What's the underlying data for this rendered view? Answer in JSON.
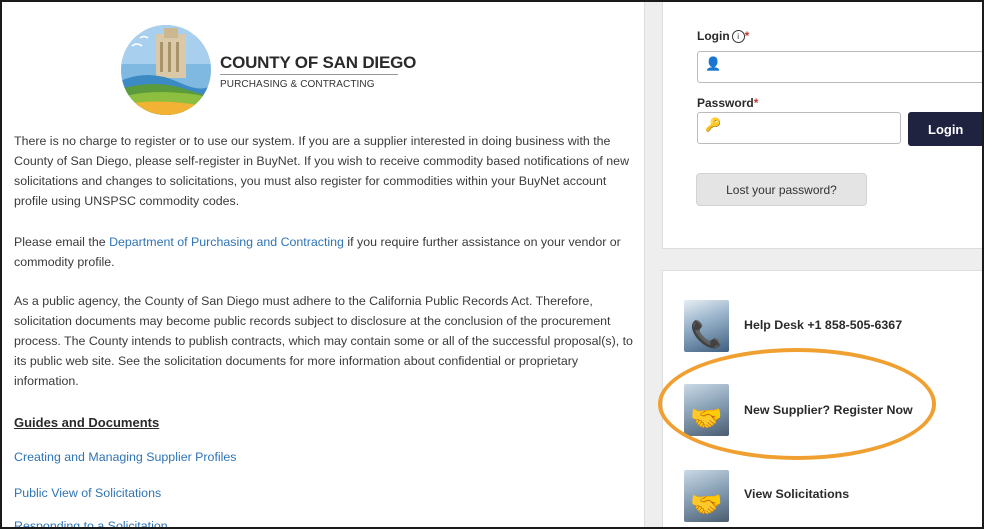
{
  "logo": {
    "title": "COUNTY OF SAN DIEGO",
    "subtitle": "PURCHASING & CONTRACTING"
  },
  "intro": {
    "p1": "There is no charge to register or to use our system. If you are a supplier interested in doing business with the County of San Diego, please self-register in BuyNet. If you wish to receive commodity based notifications of new solicitations and changes to solicitations, you must also register for commodities within your BuyNet account profile using UNSPSC commodity codes.",
    "p2_before": "Please email the ",
    "p2_link": "Department of Purchasing and Contracting",
    "p2_after": " if you require further assistance on your vendor or commodity profile.",
    "p3": "As a public agency, the County of San Diego must adhere to the California Public Records Act. Therefore, solicitation documents may become public records subject to disclosure at the conclusion of the procurement process. The County intends to publish contracts, which may contain some or all of the successful proposal(s), to its public web site. See the solicitation documents for more information about confidential or proprietary information."
  },
  "guides": {
    "heading": "Guides and Documents",
    "links": [
      "Creating and Managing Supplier Profiles",
      "Public View of Solicitations",
      "Responding to a Solicitation"
    ]
  },
  "login": {
    "login_label": "Login",
    "info_glyph": "i",
    "password_label": "Password",
    "required_mark": "*",
    "login_value": "",
    "password_value": "",
    "login_button": "Login",
    "lost_password_button": "Lost your password?"
  },
  "quick_links": [
    {
      "label": "Help Desk +1 858-505-6367",
      "icon": "person-phone-photo"
    },
    {
      "label": "New Supplier? Register Now",
      "icon": "handshake-photo"
    },
    {
      "label": "View Solicitations",
      "icon": "handshake-photo"
    }
  ],
  "colors": {
    "link": "#2f74b5",
    "login_button_bg": "#1f2340",
    "highlight": "#f0a030",
    "required": "#c0392b"
  }
}
